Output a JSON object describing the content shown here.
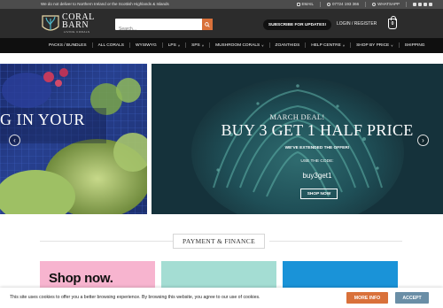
{
  "topbar": {
    "notice": "We do not deliver to Northern Ireland or the Scottish Highlands & Islands",
    "email_label": "EMAIL",
    "phone": "07724 193 366",
    "whatsapp_label": "WHATSAPP",
    "social_icons": [
      "facebook-icon",
      "instagram-icon",
      "tiktok-icon",
      "youtube-icon"
    ]
  },
  "header": {
    "logo_line1": "CORAL",
    "logo_line2": "BARN",
    "logo_tagline": "LIVING CORALS",
    "search_placeholder": "Search...",
    "subscribe_label": "SUBSCRIBE FOR UPDATES!",
    "login_label": "LOGIN / REGISTER",
    "cart_count": "0"
  },
  "nav": {
    "items": [
      {
        "label": "PACKS / BUNDLES",
        "dropdown": false
      },
      {
        "label": "ALL CORALS",
        "dropdown": false
      },
      {
        "label": "WYSIWYG",
        "dropdown": false
      },
      {
        "label": "LPS",
        "dropdown": true
      },
      {
        "label": "SPS",
        "dropdown": true
      },
      {
        "label": "MUSHROOM CORALS",
        "dropdown": true
      },
      {
        "label": "ZOANTHIDS",
        "dropdown": false
      },
      {
        "label": "HELP CENTRE",
        "dropdown": true
      },
      {
        "label": "SHOP BY PRICE",
        "dropdown": true
      },
      {
        "label": "SHIPPING",
        "dropdown": false
      }
    ]
  },
  "slider": {
    "left_headline": "G IN YOUR",
    "deal_subtitle": "MARCH DEAL!",
    "deal_title": "BUY 3 GET 1 HALF PRICE",
    "extended_text": "WE'VE EXTENDED THE OFFER!",
    "code_label": "USE THE CODE:",
    "code": "buy3get1",
    "shop_button": "SHOP NOW"
  },
  "payment": {
    "heading": "PAYMENT & FINANCE"
  },
  "cards": {
    "pink_text": "Shop now."
  },
  "cookie": {
    "message": "This site uses cookies to offer you a better browsing experience. By browsing this website, you agree to our use of cookies.",
    "more_info_label": "MORE INFO",
    "accept_label": "ACCEPT"
  },
  "colors": {
    "accent_orange": "#d9713a",
    "accept_blue": "#6a8ea6",
    "nav_bg": "#0f0f0f",
    "header_bg": "#2c2c2c"
  }
}
